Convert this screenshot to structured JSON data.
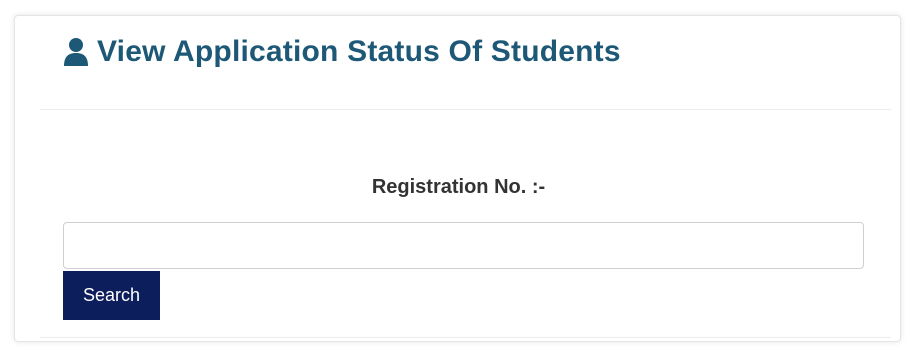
{
  "header": {
    "icon": "user-icon",
    "title": "View Application Status Of Students"
  },
  "form": {
    "label": "Registration No. :-",
    "input_value": "",
    "input_placeholder": "",
    "search_label": "Search"
  },
  "colors": {
    "title": "#1d5877",
    "button_bg": "#0c1e5c",
    "button_text": "#ffffff",
    "label": "#333333"
  }
}
